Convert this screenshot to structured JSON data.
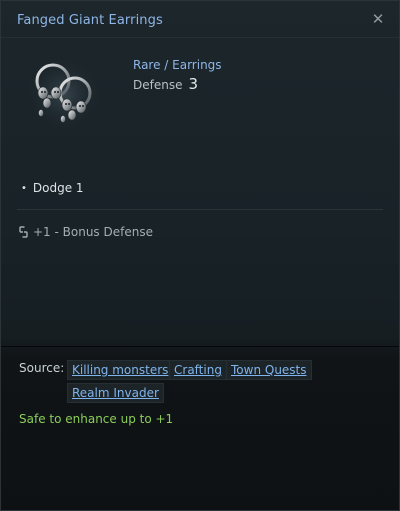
{
  "tooltip": {
    "title": "Fanged Giant Earrings",
    "close_icon": "close-icon",
    "item_icon": "earrings-icon",
    "grade_type": "Rare / Earrings",
    "stat_label": "Defense",
    "stat_value": "3",
    "effects": [
      "Dodge 1"
    ],
    "bonus_icon": "link-icon",
    "bonus": "+1 - Bonus Defense",
    "source_label": "Source:",
    "sources": [
      "Killing monsters",
      "Crafting",
      "Town Quests",
      "Realm Invader"
    ],
    "enhance_note": "Safe to enhance up to +1"
  },
  "colors": {
    "title": "#8fb6e6",
    "link": "#7fb4ec",
    "safe": "#8bcc5a"
  }
}
